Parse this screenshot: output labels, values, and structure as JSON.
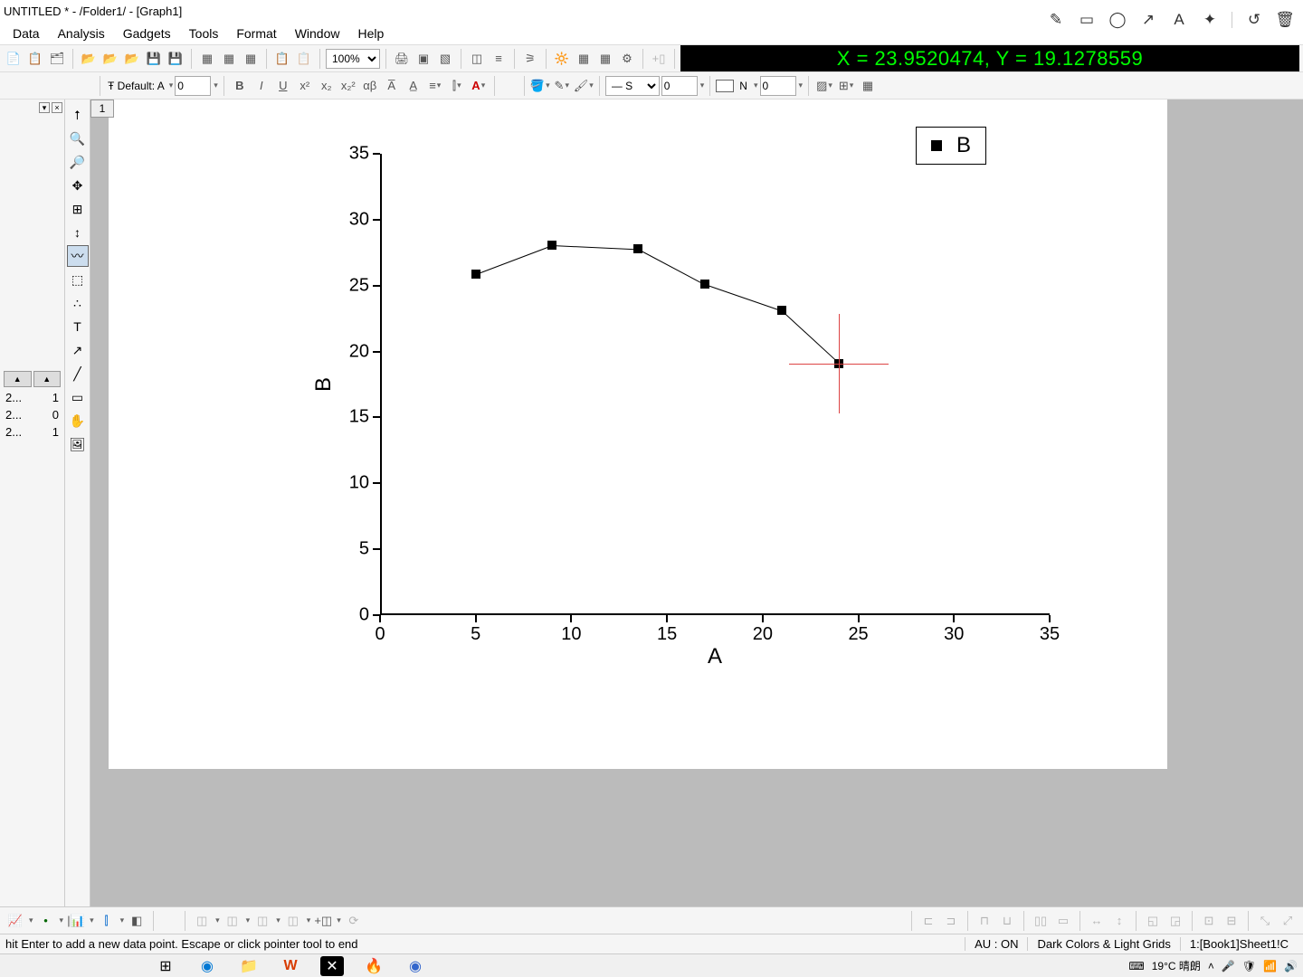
{
  "title": "UNTITLED * - /Folder1/ - [Graph1]",
  "menu": [
    "Data",
    "Analysis",
    "Gadgets",
    "Tools",
    "Format",
    "Window",
    "Help"
  ],
  "right_tools": [
    "pen",
    "rect",
    "circle",
    "arrow",
    "text",
    "wand",
    "undo",
    "trash"
  ],
  "toolbar1": {
    "zoom": "100%"
  },
  "coord": "X = 23.9520474, Y = 19.1278559",
  "toolbar2": {
    "font_label": "Default: A",
    "font_size": "0",
    "line_val": "0",
    "n_label": "N",
    "n_val": "0"
  },
  "left_panel": {
    "rows": [
      {
        "a": "2...",
        "b": "1"
      },
      {
        "a": "2...",
        "b": "0"
      },
      {
        "a": "2...",
        "b": "1"
      }
    ]
  },
  "graph": {
    "tab": "1",
    "legend": "B",
    "xlabel": "A",
    "ylabel": "B",
    "x_ticks": [
      0,
      5,
      10,
      15,
      20,
      25,
      30,
      35
    ],
    "y_ticks": [
      0,
      5,
      10,
      15,
      20,
      25,
      30,
      35
    ]
  },
  "chart_data": {
    "type": "line",
    "x": [
      5,
      9,
      13.5,
      17,
      21,
      24
    ],
    "y": [
      25.9,
      28.1,
      27.8,
      25.1,
      23.1,
      19.1
    ],
    "xlabel": "A",
    "ylabel": "B",
    "xlim": [
      0,
      35
    ],
    "ylim": [
      0,
      35
    ],
    "series_name": "B",
    "cursor": {
      "x": 24,
      "y": 19.1
    }
  },
  "status": {
    "hint": "hit Enter to add a new data point. Escape or click pointer tool to end",
    "au": "AU : ON",
    "theme": "Dark Colors & Light Grids",
    "sheet": "1:[Book1]Sheet1!C"
  },
  "tray": {
    "weather": "19°C 晴朗"
  }
}
